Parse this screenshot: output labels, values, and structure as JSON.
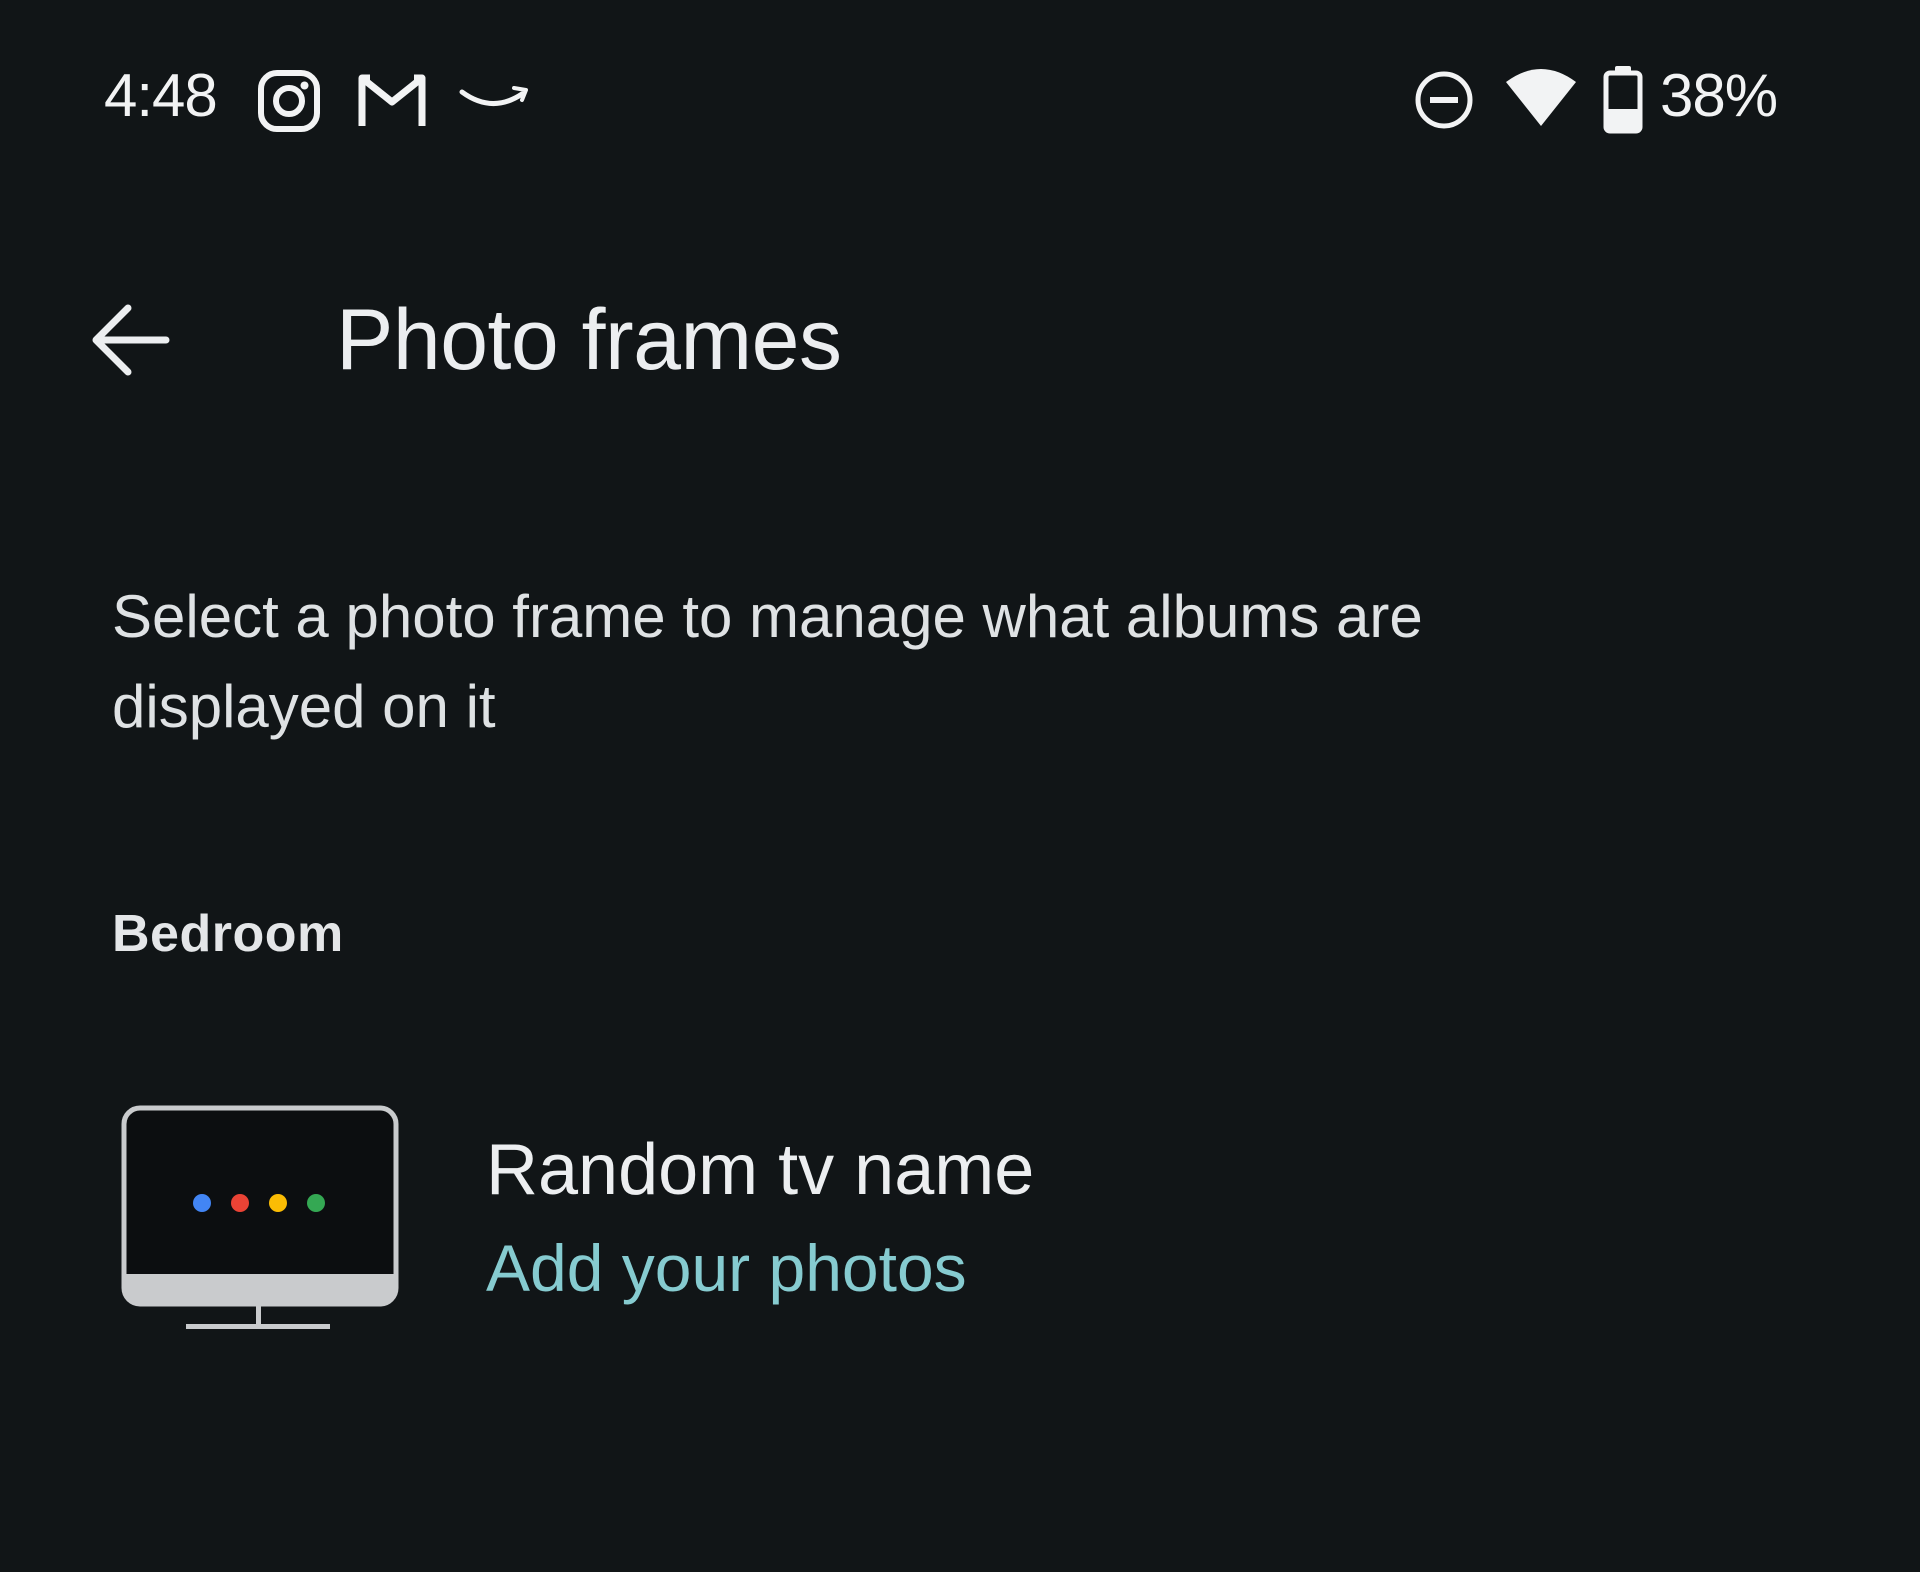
{
  "status_bar": {
    "time": "4:48",
    "notification_icons": [
      "instagram-icon",
      "gmail-icon",
      "amazon-icon"
    ],
    "system_icons": [
      "do-not-disturb-icon",
      "wifi-icon",
      "battery-icon"
    ],
    "battery_percent": "38%",
    "battery_level": 0.38
  },
  "app_bar": {
    "back_icon": "arrow-back-icon",
    "title": "Photo frames"
  },
  "description": "Select a photo frame to manage what albums are displayed on it",
  "sections": [
    {
      "header": "Bedroom",
      "devices": [
        {
          "name": "Random tv name",
          "action": "Add your photos",
          "thumbnail_icon": "tv-display-icon",
          "dot_colors": [
            "#4285F4",
            "#EA4335",
            "#FBBC04",
            "#34A853"
          ]
        }
      ]
    }
  ],
  "colors": {
    "background": "#111517",
    "text_primary": "#eceef0",
    "accent": "#86cbd0"
  }
}
